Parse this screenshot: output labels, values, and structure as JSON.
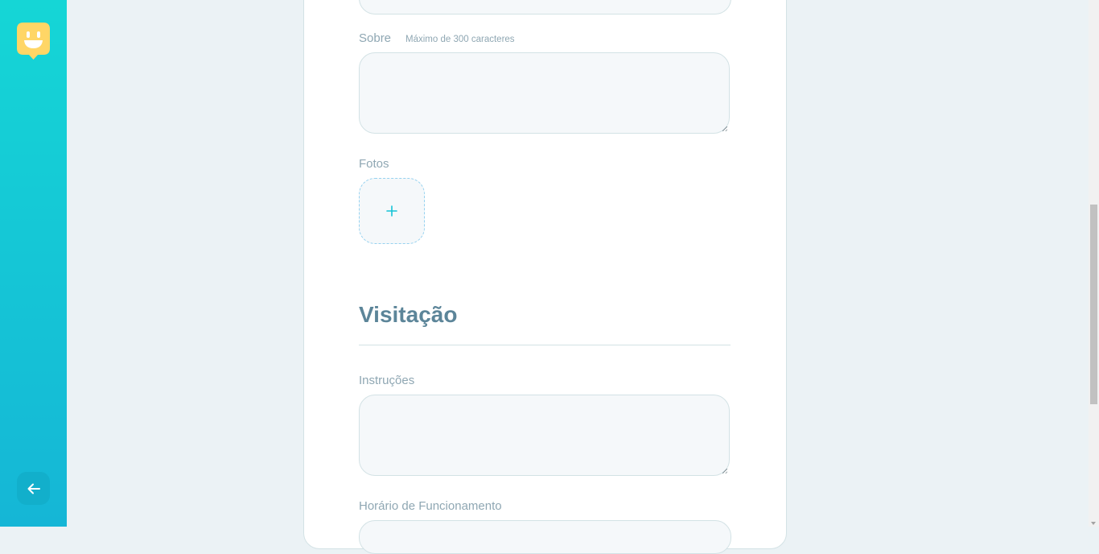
{
  "sidebar": {
    "logo_icon": "smiling-map-pin-logo",
    "back_icon": "arrow-left-icon",
    "gradient": [
      "#15d6d6",
      "#15b6d6"
    ],
    "logo_color": "#ffd666"
  },
  "form": {
    "about": {
      "label": "Sobre",
      "hint": "Máximo de 300 caracteres",
      "value": ""
    },
    "photos": {
      "label": "Fotos",
      "add_icon": "plus-icon",
      "add_symbol": "+"
    },
    "visitation": {
      "title": "Visitação",
      "instructions_label": "Instruções",
      "instructions_value": "",
      "opening_hours_label": "Horário de Funcionamento",
      "opening_hours_value": ""
    }
  },
  "colors": {
    "accent": "#15c3d6",
    "label": "#8fa7b3",
    "title": "#5c8599",
    "field_bg": "#f5f8fa",
    "field_border": "#d3e2e5"
  }
}
